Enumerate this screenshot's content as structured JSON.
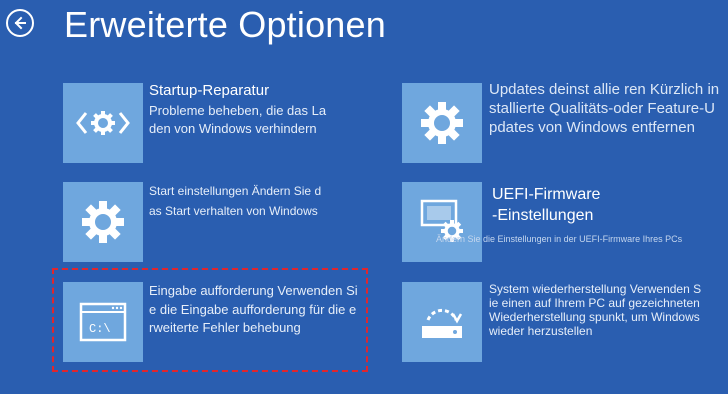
{
  "window": {
    "title": "Erweiterte Optionen"
  },
  "options": [
    {
      "title": "Startup-Reparatur",
      "desc_lines": [
        "Probleme beheben, die das La",
        "den von Windows verhindern"
      ],
      "icon": "startup-repair-icon"
    },
    {
      "title": "",
      "desc_lines": [
        "Updates deinst allie ren Kürzlich in",
        "stallierte Qualitäts-oder Feature-U",
        "pdates von Windows entfernen"
      ],
      "icon": "gear-icon"
    },
    {
      "title": "",
      "desc_lines": [
        "Start einstellungen Ändern Sie d",
        "as Start verhalten von Windows"
      ],
      "icon": "gear-icon"
    },
    {
      "title_lines": [
        "UEFI-Firmware",
        "-Einstellungen"
      ],
      "desc_lines": [
        "Ändern Sie die Einstellungen in der UEFI-Firmware Ihres PCs"
      ],
      "icon": "uefi-firmware-icon"
    },
    {
      "title": "",
      "desc_lines": [
        "Eingabe aufforderung Verwenden Si",
        "e die Eingabe aufforderung für die e",
        "rweiterte Fehler behebung"
      ],
      "icon": "command-prompt-icon",
      "icon_text": "C:\\"
    },
    {
      "title": "",
      "desc_lines": [
        "System wiederherstellung Verwenden S",
        "ie einen auf Ihrem PC auf gezeichneten",
        "Wiederherstellung spunkt, um Windows",
        "wieder herzustellen"
      ],
      "icon": "system-restore-icon"
    }
  ],
  "colors": {
    "background": "#2A5EB0",
    "tile": "#6FA7DE",
    "highlight": "#E0262E"
  }
}
